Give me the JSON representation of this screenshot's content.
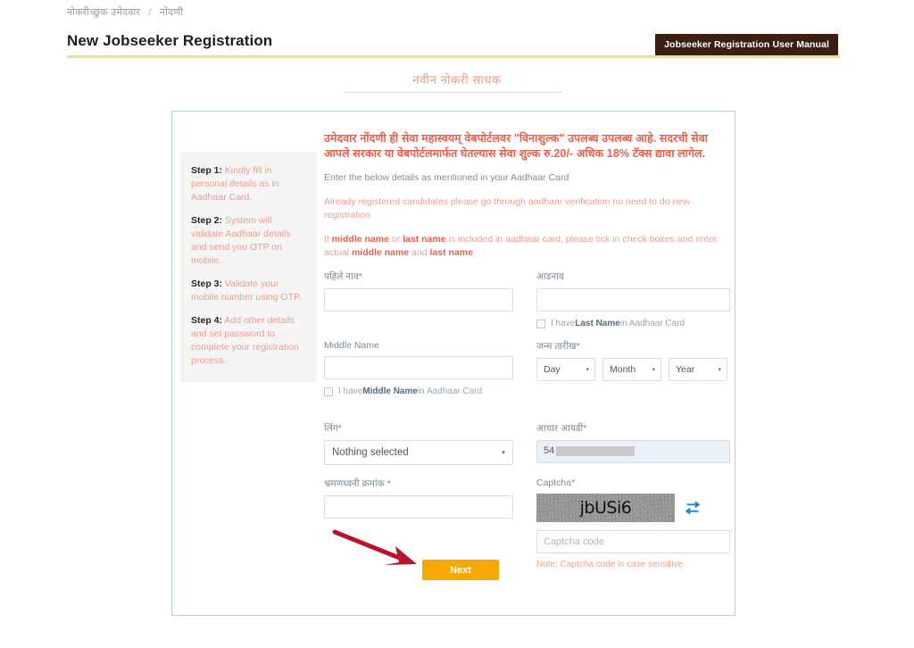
{
  "header": {
    "breadcrumb_parent": "नोकरीच्छुक उमेदवार",
    "breadcrumb_sep": "/",
    "breadcrumb_current": "नोंदणी",
    "page_title": "New Jobseeker Registration",
    "manual_button": "Jobseeker Registration User Manual"
  },
  "sub_heading": "नवीन नोकरी साधक",
  "steps": [
    {
      "label": "Step 1:",
      "text": " Kindly fill in personal details as in Aadhaar Card."
    },
    {
      "label": "Step 2:",
      "text": " System will validate Aadhaar details and send you OTP on mobile."
    },
    {
      "label": "Step 3:",
      "text": " Validate your mobile number using OTP."
    },
    {
      "label": "Step 4:",
      "text": " Add other details and set password to complete your registration process."
    }
  ],
  "notices": {
    "red_marathi": "उमेदवार नोंदणी ही सेवा महास्वयम् वेबपोर्टलवर \"विनाशुल्क\" उपलब्ध उपलब्ध आहे. सदरची सेवा आपले सरकार या वेबपोर्टलमार्फत घेतल्यास सेवा शुल्क रु.20/- अधिक 18% टॅक्स द्यावा लागेल.",
    "gray_line": "Enter the below details as mentioned in your Aadhaar Card",
    "salmon_line": "Already registered candidates please go through aadhaar verification no need to do new registration",
    "middle_name_note_1": "If ",
    "middle_name_note_b1": "middle name",
    "middle_name_note_2": " or ",
    "middle_name_note_b2": "last name",
    "middle_name_note_3": " is included in aadhaar card, please tick in check boxes and enter actual ",
    "middle_name_note_b3": "middle name",
    "middle_name_note_4": " and ",
    "middle_name_note_b4": "last name"
  },
  "form": {
    "first_name_label": "पहिले नाव*",
    "first_name_value": "",
    "last_name_label": "आडनाव",
    "last_name_value": "",
    "last_name_check_1": "I have",
    "last_name_check_b": "Last Name",
    "last_name_check_2": " in Aadhaar Card",
    "middle_name_label": "Middle Name",
    "middle_name_value": "",
    "middle_name_check_1": "I have ",
    "middle_name_check_b": "Middle Name",
    "middle_name_check_2": " in Aadhaar Card",
    "dob_label": "जन्म तारीख*",
    "dob_day": "Day",
    "dob_month": "Month",
    "dob_year": "Year",
    "gender_label": "लिंग*",
    "gender_value": "Nothing selected",
    "aadhaar_label": "आधार आयडी*",
    "aadhaar_value": "54",
    "mobile_label": "भ्रमणध्वनी क्रमांक *",
    "mobile_value": "",
    "captcha_label": "Captcha*",
    "captcha_text": "jbUSi6",
    "captcha_input_placeholder": "Captcha code",
    "captcha_input_value": "",
    "captcha_note": "Note: Captcha code is case sensitive.",
    "next_button": "Next",
    "caret_glyph": "▾"
  },
  "colors": {
    "accent_gold": "#f5a800",
    "manual_btn_bg": "#3a1f12",
    "notice_red": "#e8604f",
    "salmon": "#ef9e8e",
    "card_border": "#b9cfd8",
    "arrow_red": "#b5162c"
  }
}
